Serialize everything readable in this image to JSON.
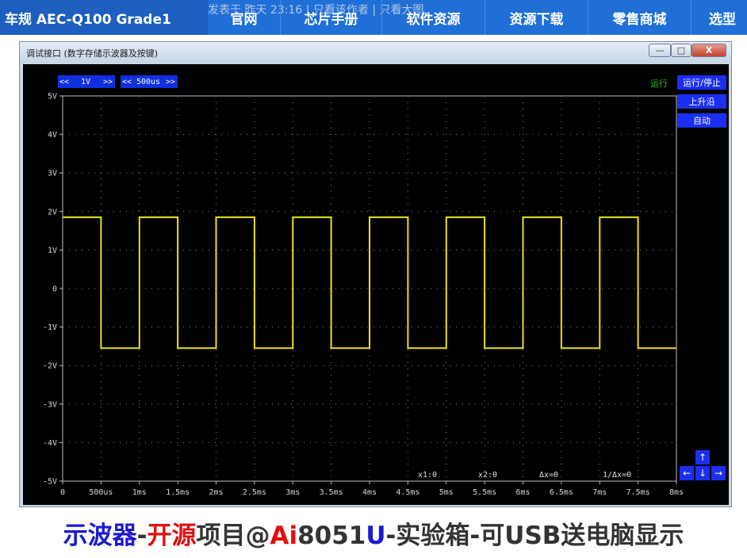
{
  "nav": {
    "brand": "车规 AEC-Q100 Grade1",
    "ghost_text": "发表于 昨天 23:16 | 只看该作者 | 只看大图",
    "items": [
      "官网",
      "芯片手册",
      "软件资源",
      "资源下载",
      "零售商城",
      "选型"
    ]
  },
  "window": {
    "title": "调试接口 (数字存储示波器及按键)",
    "min": "—",
    "max": "□",
    "close": "X"
  },
  "scope": {
    "volt_prev": "<<",
    "volt_value": "1V",
    "volt_next": ">>",
    "time_prev": "<<",
    "time_value": "500us",
    "time_next": ">>",
    "status": "运行",
    "run_stop": "运行/停止",
    "edge": "上升沿",
    "auto": "自动",
    "arrow_up": "↑",
    "arrow_left": "←",
    "arrow_down": "↓",
    "arrow_right": "→",
    "readouts": {
      "x1": "x1:0",
      "x2": "x2:0",
      "dx": "Δx=0",
      "inv_dx": "1/Δx=0"
    },
    "trace_color": "#e8e020",
    "grid_color": "#8a8a8a"
  },
  "chart_data": {
    "type": "line",
    "title": "",
    "xlabel": "",
    "ylabel": "",
    "y_ticks": [
      "5V",
      "4V",
      "3V",
      "2V",
      "1V",
      "0",
      "-1V",
      "-2V",
      "-3V",
      "-4V",
      "-5V"
    ],
    "x_ticks": [
      "0",
      "500us",
      "1ms",
      "1.5ms",
      "2ms",
      "2.5ms",
      "3ms",
      "3.5ms",
      "4ms",
      "4.5ms",
      "5ms",
      "5.5ms",
      "6ms",
      "6.5ms",
      "7ms",
      "7.5ms",
      "8ms"
    ],
    "xlim_ms": [
      0,
      8
    ],
    "ylim_v": [
      -5,
      5
    ],
    "grid": true,
    "series": [
      {
        "color": "#e8e020",
        "points_ms_v": [
          [
            0.0,
            1.85
          ],
          [
            0.5,
            1.85
          ],
          [
            0.5,
            -1.55
          ],
          [
            1.0,
            -1.55
          ],
          [
            1.0,
            1.85
          ],
          [
            1.5,
            1.85
          ],
          [
            1.5,
            -1.55
          ],
          [
            2.0,
            -1.55
          ],
          [
            2.0,
            1.85
          ],
          [
            2.5,
            1.85
          ],
          [
            2.5,
            -1.55
          ],
          [
            3.0,
            -1.55
          ],
          [
            3.0,
            1.85
          ],
          [
            3.5,
            1.85
          ],
          [
            3.5,
            -1.55
          ],
          [
            4.0,
            -1.55
          ],
          [
            4.0,
            1.85
          ],
          [
            4.5,
            1.85
          ],
          [
            4.5,
            -1.55
          ],
          [
            5.0,
            -1.55
          ],
          [
            5.0,
            1.85
          ],
          [
            5.5,
            1.85
          ],
          [
            5.5,
            -1.55
          ],
          [
            6.0,
            -1.55
          ],
          [
            6.0,
            1.85
          ],
          [
            6.5,
            1.85
          ],
          [
            6.5,
            -1.55
          ],
          [
            7.0,
            -1.55
          ],
          [
            7.0,
            1.85
          ],
          [
            7.5,
            1.85
          ],
          [
            7.5,
            -1.55
          ],
          [
            8.0,
            -1.55
          ]
        ]
      }
    ]
  },
  "caption": {
    "p1": "示波器",
    "p2": "-",
    "p3": "开源",
    "p4": "项目@",
    "p5": "Ai",
    "p6": "8051",
    "p7": "U",
    "p8": "-实验箱-可USB送电脑显示",
    "c_blue": "#1a1ad0",
    "c_red": "#e01010",
    "c_dark": "#333333"
  }
}
